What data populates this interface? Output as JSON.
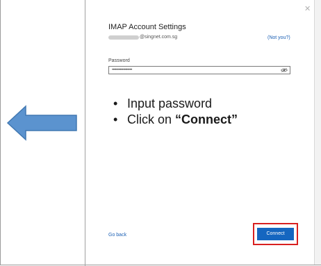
{
  "dialog": {
    "title": "IMAP Account Settings",
    "email_visible": "@singnet.com.sg",
    "not_you": "Not you?",
    "password_label": "Password",
    "password_value": "••••••••••••••••••",
    "go_back": "Go back",
    "connect": "Connect",
    "close": "✕"
  },
  "instructions": {
    "step1": "Input password",
    "step2_prefix": "Click on ",
    "step2_bold": "“Connect”"
  },
  "colors": {
    "arrow_fill": "#5b93cf",
    "arrow_stroke": "#4178b2",
    "button_blue": "#1566c0",
    "highlight_red": "#d82020",
    "link_blue": "#1a5fb4"
  },
  "icons": {
    "arrow": "left-arrow-icon",
    "close": "close-icon",
    "eye": "eye-icon"
  }
}
